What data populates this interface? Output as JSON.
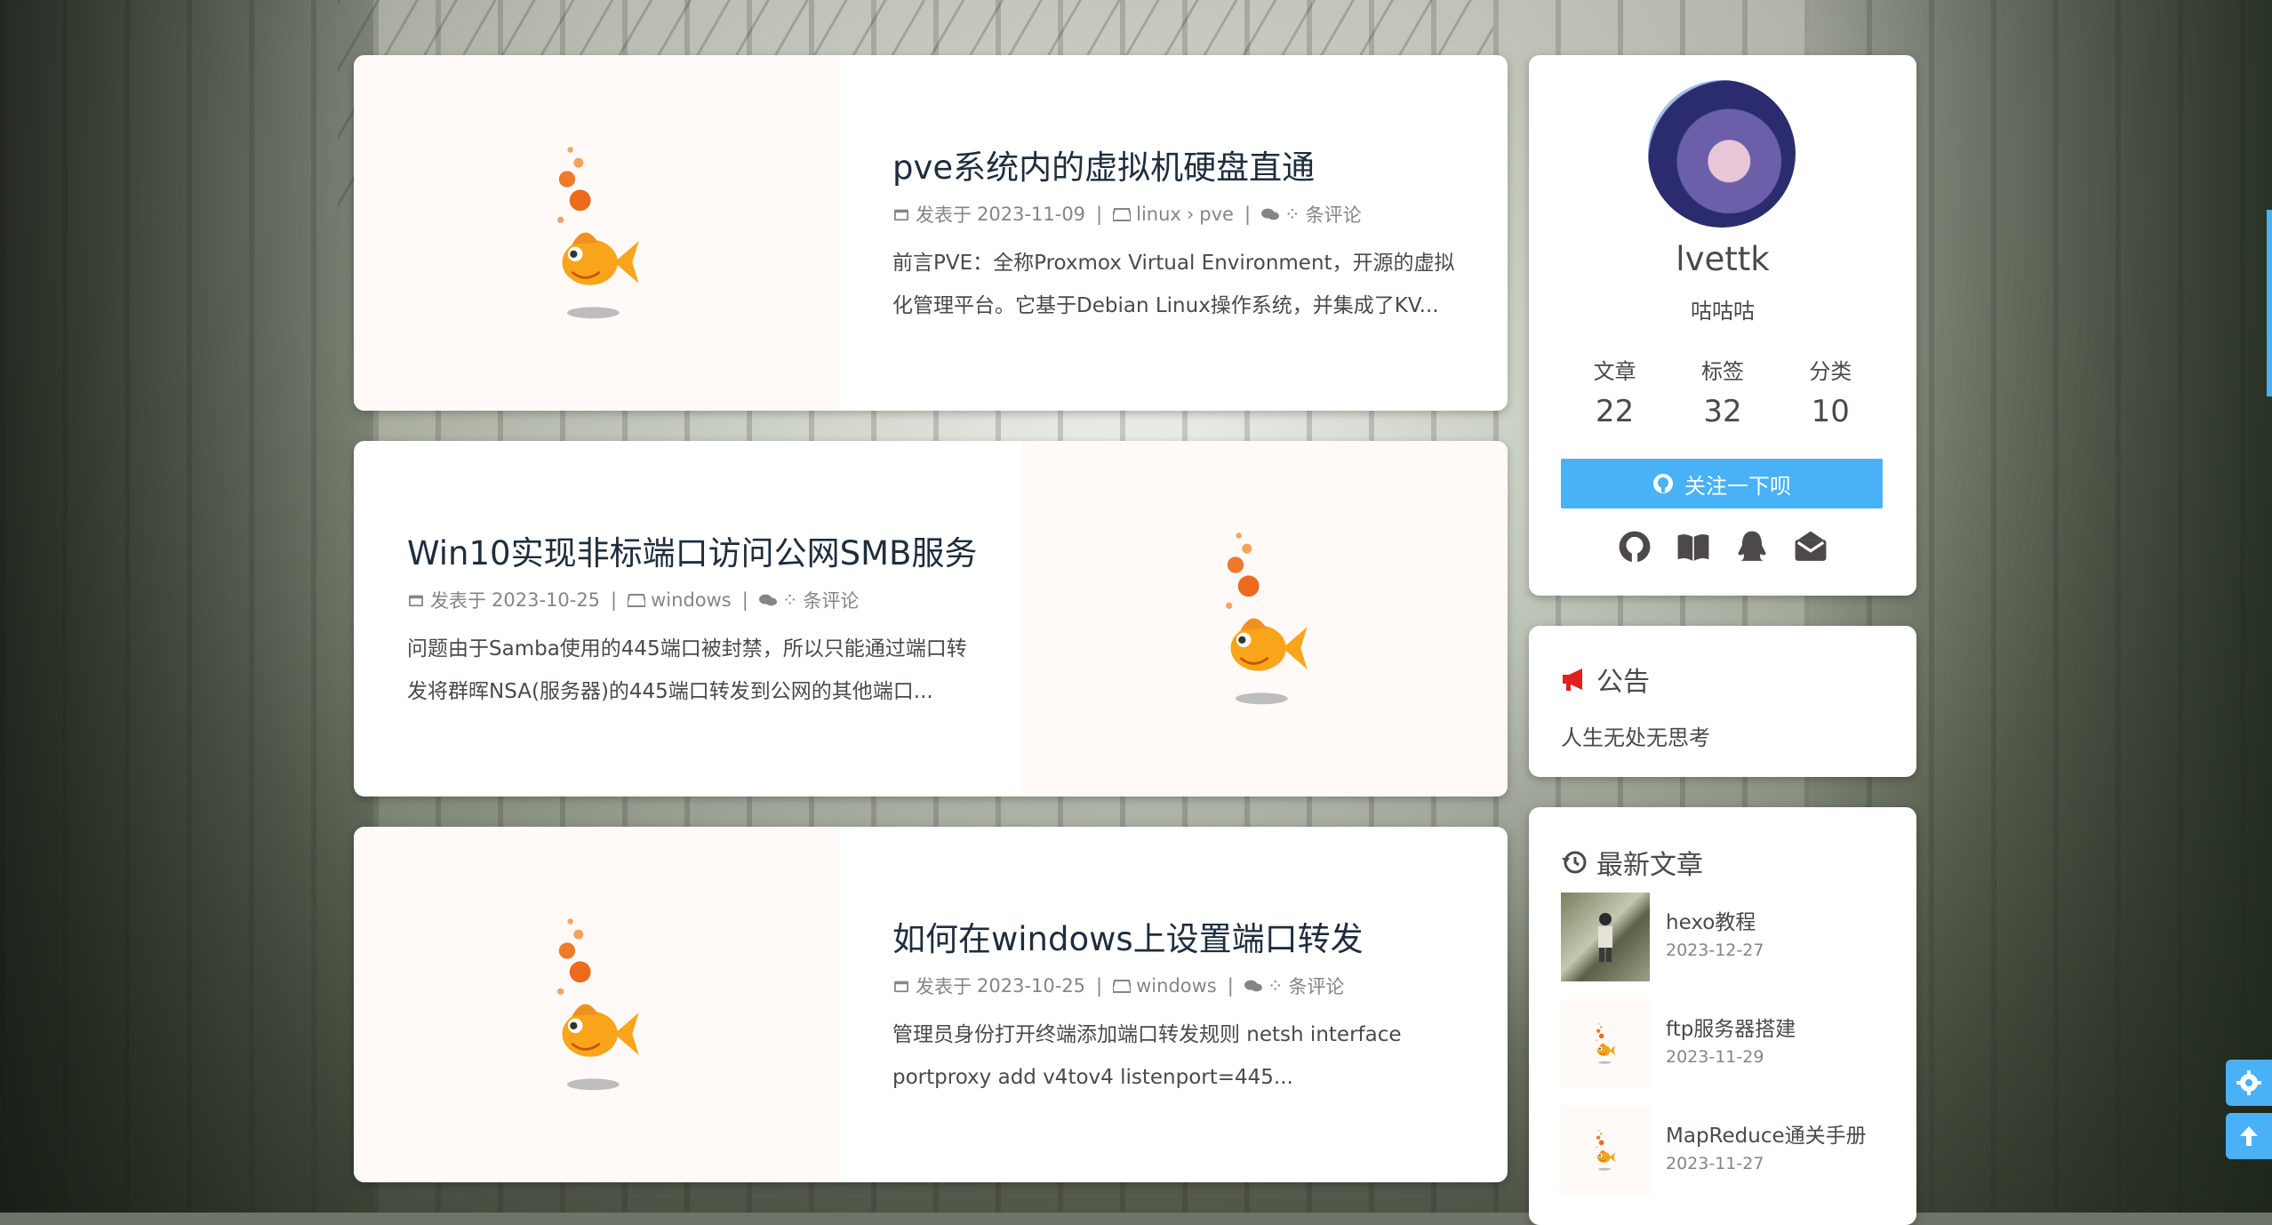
{
  "posts": [
    {
      "title": "pve系统内的虚拟机硬盘直通",
      "date_prefix": "发表于",
      "date": "2023-11-09",
      "category": "linux",
      "subcategory": "pve",
      "comments_suffix": "条评论",
      "excerpt": "前言PVE：全称Proxmox Virtual Environment，开源的虚拟化管理平台。它基于Debian Linux操作系统，并集成了KV..."
    },
    {
      "title": "Win10实现非标端口访问公网SMB服务",
      "date_prefix": "发表于",
      "date": "2023-10-25",
      "category": "windows",
      "comments_suffix": "条评论",
      "excerpt": "问题由于Samba使用的445端口被封禁，所以只能通过端口转发将群晖NSA(服务器)的445端口转发到公网的其他端口..."
    },
    {
      "title": "如何在windows上设置端口转发",
      "date_prefix": "发表于",
      "date": "2023-10-25",
      "category": "windows",
      "comments_suffix": "条评论",
      "excerpt": "管理员身份打开终端添加端口转发规则 netsh interface portproxy add v4tov4 listenport=445..."
    }
  ],
  "profile": {
    "author": "lvettk",
    "motto": "咕咕咕",
    "stats": [
      {
        "label": "文章",
        "value": "22"
      },
      {
        "label": "标签",
        "value": "32"
      },
      {
        "label": "分类",
        "value": "10"
      }
    ],
    "follow_label": "关注一下呗",
    "social_icons": [
      "github-icon",
      "book-icon",
      "qq-icon",
      "mail-icon"
    ]
  },
  "notice": {
    "title": "公告",
    "text": "人生无处无思考"
  },
  "recent": {
    "title": "最新文章",
    "items": [
      {
        "title": "hexo教程",
        "date": "2023-12-27"
      },
      {
        "title": "ftp服务器搭建",
        "date": "2023-11-29"
      },
      {
        "title": "MapReduce通关手册",
        "date": "2023-11-27"
      }
    ]
  },
  "colors": {
    "accent": "#49b1f5",
    "title": "#1f2d3d",
    "text": "#4c4948",
    "meta": "#858585",
    "notice_icon": "#e02020"
  }
}
